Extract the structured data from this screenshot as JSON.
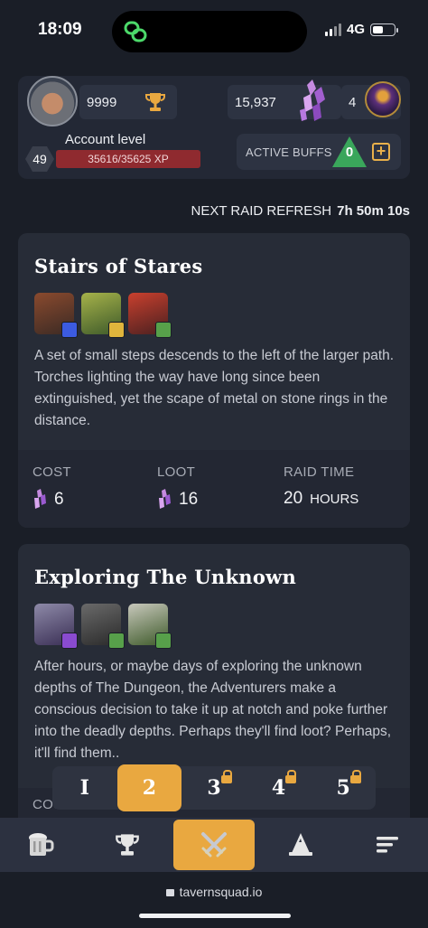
{
  "status_bar": {
    "time": "18:09",
    "network": "4G",
    "battery_fraction": 0.55
  },
  "header": {
    "trophies": "9999",
    "gems": "15,937",
    "orbs": "4",
    "account_label": "Account level",
    "level": "49",
    "xp_text": "35616/35625 XP",
    "xp_progress": 0.9997,
    "active_buffs_label": "ACTIVE BUFFS",
    "active_buffs_count": "0"
  },
  "refresh": {
    "label": "NEXT RAID REFRESH",
    "time": "7h 50m 10s"
  },
  "raids": [
    {
      "title": "Stairs of Stares",
      "description": "A set of small steps descends to the left of the larger path. Torches lighting the way have long since been extinguished, yet the scape of metal on stone rings in the distance.",
      "cost_label": "COST",
      "cost": "6",
      "loot_label": "LOOT",
      "loot": "16",
      "time_label": "RAID TIME",
      "time_value": "20",
      "time_unit": "HOURS"
    },
    {
      "title": "Exploring The Unknown",
      "description": "After hours, or maybe days of exploring the unknown depths of The Dungeon, the Adventurers make a conscious decision to take it up at notch and poke further into the deadly depths. Perhaps they'll find loot? Perhaps, it'll find them..",
      "cost_label": "COST"
    }
  ],
  "pagination": {
    "pages": [
      "I",
      "2",
      "3",
      "4",
      "5"
    ],
    "active_index": 1
  },
  "url_bar": {
    "url": "tavernsquad.io"
  },
  "colors": {
    "accent": "#e9a840",
    "xp": "#8f2a2f",
    "buff": "#3aa65b",
    "background": "#1a1e27",
    "card": "#272c37"
  }
}
